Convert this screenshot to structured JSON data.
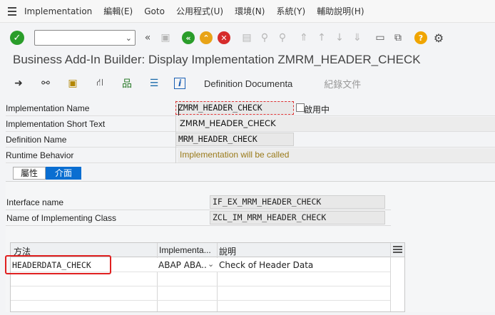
{
  "menu": {
    "items": [
      "Implementation",
      "編輯(E)",
      "Goto",
      "公用程式(U)",
      "環境(N)",
      "系統(Y)",
      "輔助說明(H)"
    ]
  },
  "toolbar": {
    "command_value": "",
    "icons": [
      "check-icon",
      "command-field",
      "double-left-icon",
      "save-icon",
      "back-icon",
      "exit-icon",
      "cancel-icon",
      "print-icon",
      "find-icon",
      "find-next-icon",
      "first-page-icon",
      "prev-page-icon",
      "next-page-icon",
      "last-page-icon",
      "new-session-icon",
      "shortcut-icon",
      "help-icon",
      "settings-icon"
    ]
  },
  "page": {
    "title": "Business Add-In Builder: Display Implementation ZMRM_HEADER_CHECK"
  },
  "app_toolbar": {
    "definition_doc": "Definition Documenta",
    "doc_label": "紀錄文件"
  },
  "fields": {
    "impl_name_label": "Implementation Name",
    "impl_name_value": "ZMRM_HEADER_CHECK",
    "active_label": "啟用中",
    "short_text_label": "Implementation Short Text",
    "short_text_value": "ZMRM_HEADER_CHECK",
    "def_name_label": "Definition Name",
    "def_name_value": "MRM_HEADER_CHECK",
    "runtime_label": "Runtime Behavior",
    "runtime_value": "Implementation will be called"
  },
  "tabs": {
    "properties": "屬性",
    "interface": "介面"
  },
  "interface": {
    "name_label": "Interface name",
    "name_value": "IF_EX_MRM_HEADER_CHECK",
    "class_label": "Name of Implementing Class",
    "class_value": "ZCL_IM_MRM_HEADER_CHECK"
  },
  "grid": {
    "headers": [
      "方法",
      "Implementa...",
      "說明"
    ],
    "rows": [
      {
        "method": "HEADERDATA_CHECK",
        "impl": "ABAP ABA...",
        "desc": "Check of Header Data"
      }
    ]
  },
  "colors": {
    "accent": "#0a6ed1",
    "highlight": "#e02020",
    "ok_green": "#2a9d2a"
  }
}
